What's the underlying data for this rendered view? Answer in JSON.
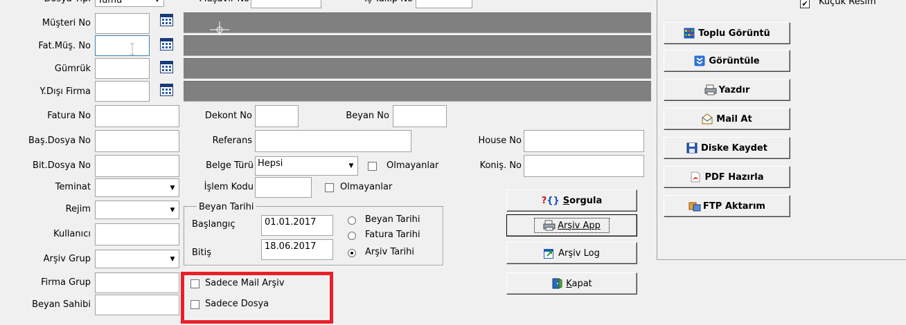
{
  "top_row": {
    "dosya_tipi_label": "Dosya Tipi",
    "dosya_tipi_value": "Tümü",
    "musavir_label": "Müşavir No",
    "is_takip_label": "İş Takip No"
  },
  "left_fields": {
    "musteri_no": "Müşteri No",
    "fat_mus_no": "Fat.Müş. No",
    "gumruk": "Gümrük",
    "y_disi_firma": "Y.Dışı Firma",
    "fatura_no": "Fatura No",
    "bas_dosya_no": "Baş.Dosya No",
    "bit_dosya_no": "Bit.Dosya No",
    "teminat": "Teminat",
    "rejim": "Rejim",
    "kullanici": "Kullanıcı",
    "arsiv_grup": "Arşiv Grup",
    "firma_grup": "Firma Grup",
    "beyan_sahibi": "Beyan Sahibi"
  },
  "middle": {
    "dekont_no": "Dekont No",
    "beyan_no": "Beyan No",
    "referans": "Referans",
    "belge_turu_label": "Belge Türü",
    "belge_turu_value": "Hepsi",
    "olmayanlar_1": "Olmayanlar",
    "islem_kodu": "İşlem Kodu",
    "olmayanlar_2": "Olmayanlar",
    "house_no": "House No",
    "konis_no": "Koniş. No"
  },
  "beyan_tarihi_group": {
    "title": "Beyan Tarihi",
    "baslangic_label": "Başlangıç",
    "baslangic_value": "01.01.2017",
    "bitis_label": "Bitiş",
    "bitis_value": "18.06.2017",
    "radio_beyan": "Beyan Tarihi",
    "radio_fatura": "Fatura Tarihi",
    "radio_arsiv": "Arşiv Tarihi",
    "selected": "radio_arsiv"
  },
  "checkboxes": {
    "sadece_mail_arsiv": "Sadece Mail Arşiv",
    "sadece_dosya": "Sadece Dosya"
  },
  "action_buttons": {
    "sorgula_prefix": "S",
    "sorgula_rest": "orgula",
    "arsiv_app": "Arşiv App",
    "arsiv_log": "Arşiv Log",
    "kapat_prefix": "K",
    "kapat_rest": "apat"
  },
  "right_panel": {
    "kucuk_resim": "Küçük Resim",
    "kucuk_resim_checked": true,
    "toplu_goruntu": "Toplu Görüntü",
    "goruntule": "Görüntüle",
    "yazdir": "Yazdır",
    "mail_at": "Mail At",
    "diske_kaydet": "Diske Kaydet",
    "pdf_hazirla": "PDF Hazırla",
    "ftp_aktarim": "FTP Aktarım"
  },
  "colors": {
    "highlight_box": "#e8202a",
    "grey_fields": "#808080",
    "window_bg": "#f0f0f0"
  }
}
